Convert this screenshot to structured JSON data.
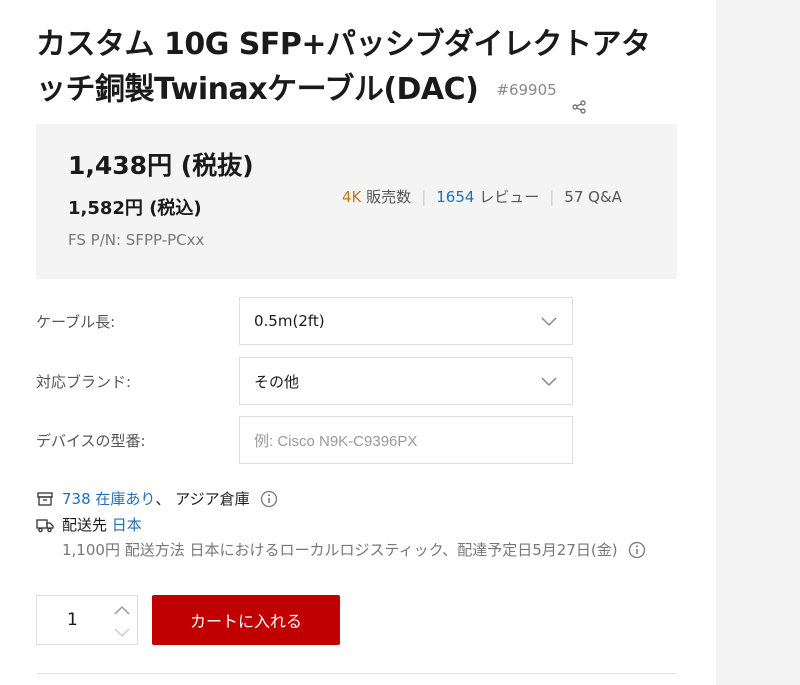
{
  "product": {
    "title": "カスタム 10G SFP+パッシブダイレクトアタッチ銅製Twinaxケーブル(DAC)",
    "sku": "#69905"
  },
  "pricing": {
    "price_ex_tax": "1,438円 (税抜)",
    "price_in_tax": "1,582円 (税込)",
    "part_number": "FS P/N: SFPP-PCxx"
  },
  "stats": {
    "sold_count": "4K",
    "sold_label": "販売数",
    "review_count": "1654",
    "review_label": "レビュー",
    "qa_count": "57",
    "qa_label": "Q&A"
  },
  "options": {
    "cable_length_label": "ケーブル長:",
    "cable_length_value": "0.5m(2ft)",
    "brand_label": "対応ブランド:",
    "brand_value": "その他",
    "device_model_label": "デバイスの型番:",
    "device_model_placeholder": "例:  Cisco N9K-C9396PX"
  },
  "stock": {
    "count_text": "738 在庫あり",
    "warehouse": "、 アジア倉庫",
    "ship_to_label": "配送先",
    "ship_to_value": "日本",
    "shipping_detail": "1,100円 配送方法 日本におけるローカルロジスティック、配達予定日5月27日(金)"
  },
  "cart": {
    "quantity": "1",
    "add_to_cart_label": "カートに入れる"
  },
  "colors": {
    "accent_red": "#c00000",
    "link_blue": "#1f6fbd",
    "sold_orange": "#c0771b"
  }
}
